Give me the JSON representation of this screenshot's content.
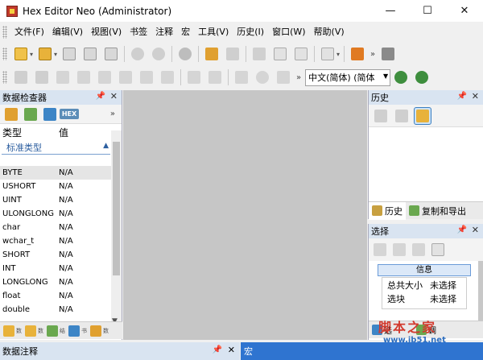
{
  "window": {
    "title": "Hex Editor Neo (Administrator)",
    "controls": {
      "minimize": "—",
      "maximize": "☐",
      "close": "✕"
    }
  },
  "menu": [
    "文件(F)",
    "编辑(V)",
    "视图(V)",
    "书签",
    "注释",
    "宏",
    "工具(V)",
    "历史(I)",
    "窗口(W)",
    "帮助(V)"
  ],
  "toolbar1": {
    "icons": [
      "new-file",
      "open-folder",
      "save",
      "save-as",
      "save-all",
      "stop",
      "stop-all",
      "refresh",
      "modify",
      "modify-alt",
      "link",
      "ifo",
      "txt",
      "le-mode",
      "grid-select",
      "tools"
    ],
    "overflow": "»"
  },
  "toolbar2": {
    "icons": [
      "undo",
      "redo",
      "cut",
      "copy",
      "paste",
      "pencil",
      "insert",
      "delete",
      "cut-alt",
      "erase",
      "list",
      "settings",
      "print"
    ],
    "overflow": "»",
    "encoding": "中文(简体) (简体"
  },
  "inspector": {
    "title": "数据检查器",
    "hex_badge": "HEX",
    "col_type": "类型",
    "col_value": "值",
    "group": "标准类型",
    "rows": [
      {
        "type": "BYTE",
        "value": "N/A"
      },
      {
        "type": "USHORT",
        "value": "N/A"
      },
      {
        "type": "UINT",
        "value": "N/A"
      },
      {
        "type": "ULONGLONG",
        "value": "N/A"
      },
      {
        "type": "char",
        "value": "N/A"
      },
      {
        "type": "wchar_t",
        "value": "N/A"
      },
      {
        "type": "SHORT",
        "value": "N/A"
      },
      {
        "type": "INT",
        "value": "N/A"
      },
      {
        "type": "LONGLONG",
        "value": "N/A"
      },
      {
        "type": "float",
        "value": "N/A"
      },
      {
        "type": "double",
        "value": "N/A"
      }
    ],
    "tab_labels": [
      "数",
      "数",
      "结",
      "书",
      "数"
    ]
  },
  "history": {
    "title": "历史",
    "tabs": [
      "历史",
      "复制和导出"
    ]
  },
  "selection": {
    "title": "选择",
    "info_header": "信息",
    "rows": [
      {
        "key": "总共大小",
        "value": "未选择"
      },
      {
        "key": "选块",
        "value": "未选择"
      }
    ],
    "tab_labels": [
      "选",
      "调"
    ]
  },
  "bottom": {
    "left_title": "数据注释",
    "right_title": "宏"
  },
  "watermark": {
    "logo": "脚本之家",
    "url": "www.jb51.net"
  },
  "colors": {
    "panel_header": "#d9e4f1",
    "active_header": "#2f74d0",
    "editor_bg": "#c6c6c6",
    "group_text": "#2d5fa0"
  }
}
